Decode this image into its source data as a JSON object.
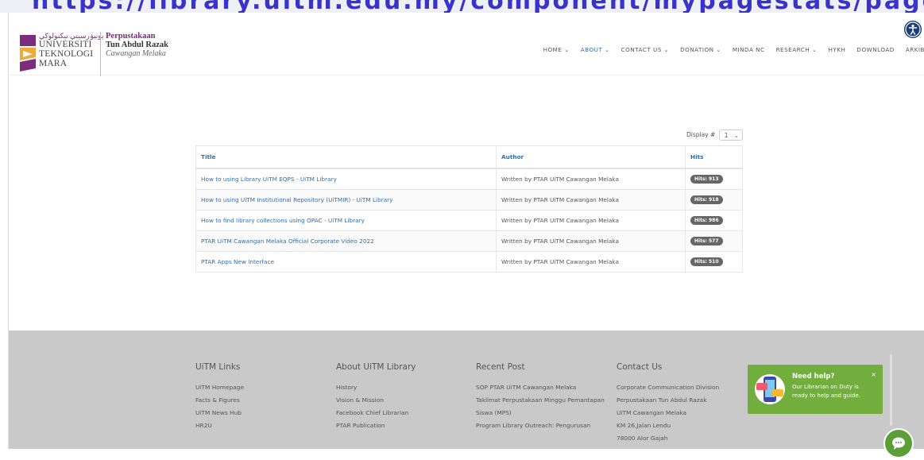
{
  "banner_url": "https://library.uitm.edu.my/component/mypagestats/pages",
  "header": {
    "logo": {
      "jawi": "يونيۏرسيتي تيكنولوڬي مارا",
      "line1": "UNIVERSITI",
      "line2": "TEKNOLOGI",
      "line3": "MARA"
    },
    "library": {
      "line1": "Perpustakaan",
      "line2": "Tun Abdul Razak",
      "line3": "Cawangan Melaka"
    },
    "nav": [
      {
        "label": "HOME ⌄"
      },
      {
        "label": "ABOUT ⌄"
      },
      {
        "label": "CONTACT US ⌄"
      },
      {
        "label": "DONATION ⌄"
      },
      {
        "label": "MINDA NC"
      },
      {
        "label": "RESEARCH ⌄"
      },
      {
        "label": "HYKH"
      },
      {
        "label": "DOWNLOAD"
      },
      {
        "label": "ARKIB"
      }
    ],
    "active_nav": "ABOUT"
  },
  "display": {
    "label": "Display #",
    "value": "1"
  },
  "table": {
    "headers": {
      "title": "Title",
      "author": "Author",
      "hits": "Hits"
    },
    "rows": [
      {
        "title": "How to using Library UiTM EQPS - UiTM Library",
        "author": "Written by PTAR UiTM Cawangan Melaka",
        "hits": "Hits: 913"
      },
      {
        "title": "How to using UiTM Institutional Repository (UiTMIR) - UiTM Library",
        "author": "Written by PTAR UiTM Cawangan Melaka",
        "hits": "Hits: 918"
      },
      {
        "title": "How to find library collections using OPAC - UiTM Library",
        "author": "Written by PTAR UiTM Cawangan Melaka",
        "hits": "Hits: 986"
      },
      {
        "title": "PTAR UiTM Cawangan Melaka Official Corporate Video 2022",
        "author": "Written by PTAR UiTM Cawangan Melaka",
        "hits": "Hits: 577"
      },
      {
        "title": "PTAR Apps New Interface",
        "author": "Written by PTAR UiTM Cawangan Melaka",
        "hits": "Hits: 510"
      }
    ]
  },
  "footer": {
    "uitm_links": {
      "heading": "UiTM Links",
      "items": [
        "UiTM Homepage",
        "Facts & Figures",
        "UiTM News Hub",
        "HR2U"
      ]
    },
    "about": {
      "heading": "About UiTM Library",
      "items": [
        "History",
        "Vision & Mission",
        "Facebook Chief Librarian",
        "PTAR Publication"
      ]
    },
    "recent": {
      "heading": "Recent Post",
      "items": [
        "SOP PTAR UiTM Cawangan Melaka",
        "Taklimat Perpustakaan Minggu Pemantapan",
        "Siswa (MPS)",
        "Program Library Outreach: Pengurusan"
      ]
    },
    "contact": {
      "heading": "Contact Us",
      "items": [
        "Corporate Communication Division",
        "Perpustakaan Tun Abdul Razak",
        "UiTM Cawangan Melaka",
        "KM 26,Jalan Lendu",
        "78000 Alor Gajah"
      ]
    }
  },
  "help": {
    "title": "Need help?",
    "text": "Our Librarian on Duty is ready to help and guide.",
    "close": "×"
  },
  "colors": {
    "accent": "#2c6fb3",
    "brand": "#7b2c7d",
    "help_green": "#71ae3d",
    "footer_bg": "#c9c9c9"
  },
  "icons": [
    "accessibility-icon",
    "chat-icon",
    "librarian-help-icon",
    "uitm-logo"
  ]
}
